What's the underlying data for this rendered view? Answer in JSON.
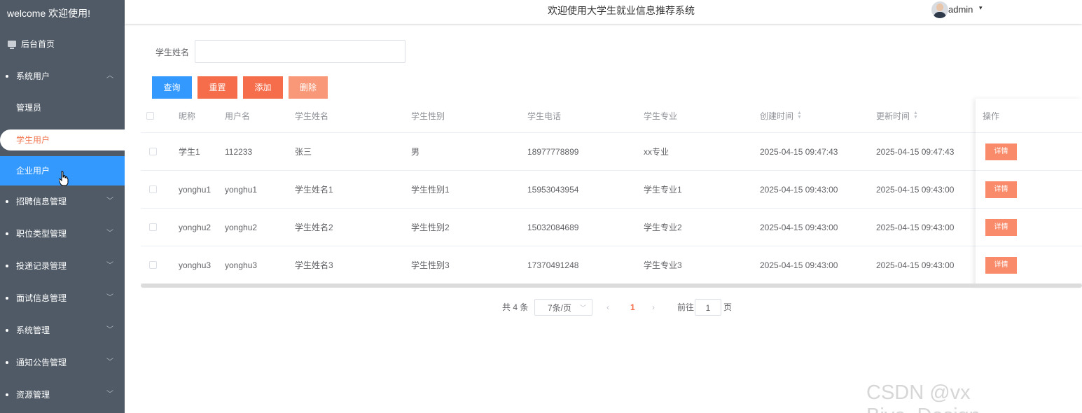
{
  "sidebar": {
    "welcome": "welcome 欢迎使用!",
    "home": "后台首页",
    "system_users": "系统用户",
    "sub_admin": "管理员",
    "sub_student": "学生用户",
    "sub_company": "企业用户",
    "menus": [
      "招聘信息管理",
      "职位类型管理",
      "投递记录管理",
      "面试信息管理",
      "系统管理",
      "通知公告管理",
      "资源管理"
    ]
  },
  "header": {
    "title": "欢迎使用大学生就业信息推荐系统",
    "user": "admin"
  },
  "search": {
    "label": "学生姓名",
    "value": "",
    "placeholder": ""
  },
  "buttons": {
    "query": "查询",
    "reset": "重置",
    "add": "添加",
    "delete": "删除"
  },
  "table": {
    "headers": [
      "昵称",
      "用户名",
      "学生姓名",
      "学生性别",
      "学生电话",
      "学生专业",
      "创建时间",
      "更新时间",
      "操作"
    ],
    "rows": [
      [
        "学生1",
        "112233",
        "张三",
        "男",
        "18977778899",
        "xx专业",
        "2025-04-15 09:47:43",
        "2025-04-15 09:47:43"
      ],
      [
        "yonghu1",
        "yonghu1",
        "学生姓名1",
        "学生性别1",
        "15953043954",
        "学生专业1",
        "2025-04-15 09:43:00",
        "2025-04-15 09:43:00"
      ],
      [
        "yonghu2",
        "yonghu2",
        "学生姓名2",
        "学生性别2",
        "15032084689",
        "学生专业2",
        "2025-04-15 09:43:00",
        "2025-04-15 09:43:00"
      ],
      [
        "yonghu3",
        "yonghu3",
        "学生姓名3",
        "学生性别3",
        "17370491248",
        "学生专业3",
        "2025-04-15 09:43:00",
        "2025-04-15 09:43:00"
      ]
    ],
    "detail_label": "详情"
  },
  "pagination": {
    "total": "共 4 条",
    "page_size": "7条/页",
    "current_page": "1",
    "goto_label": "前往",
    "goto_value": "1",
    "page_unit": "页"
  },
  "watermark": "CSDN @vx Biye_Design",
  "colors": {
    "sidebar_bg": "#4f5a66",
    "primary": "#3399ff",
    "danger": "#f56d4a",
    "detail": "#f98b6b"
  }
}
